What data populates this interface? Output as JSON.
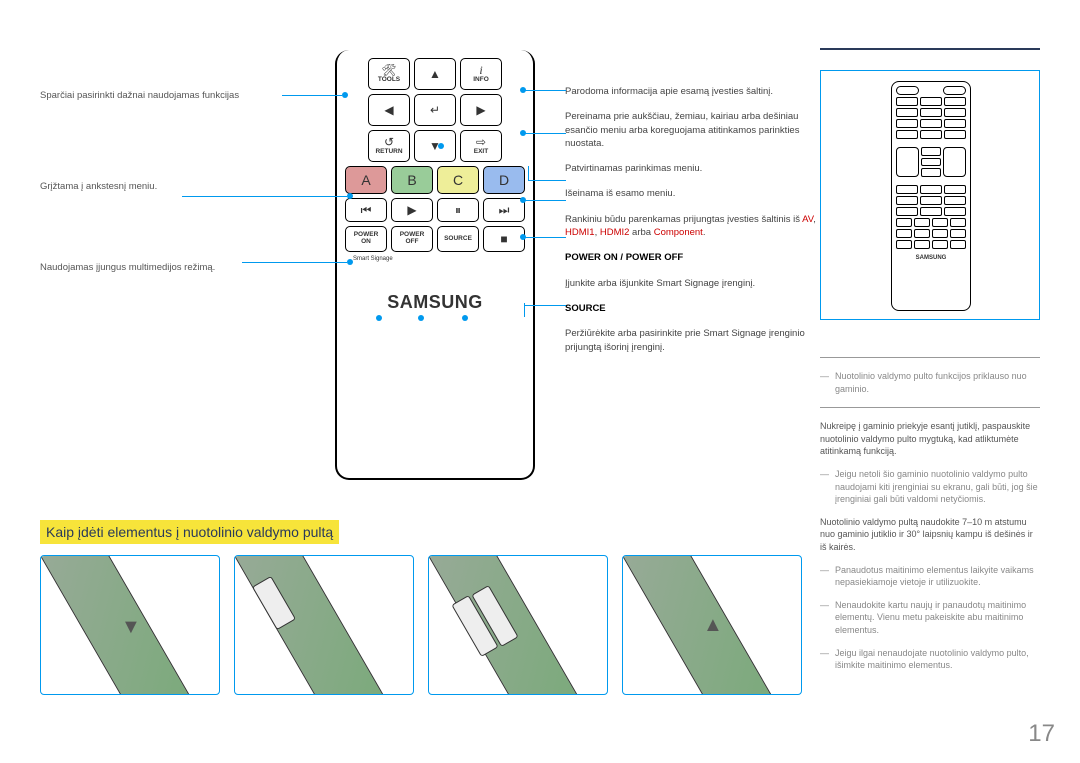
{
  "left": {
    "tools_desc": "Sparčiai pasirinkti dažnai naudojamas funkcijas",
    "return_desc": "Grįžtama į ankstesnį meniu.",
    "media_desc": "Naudojamas įjungus multimedijos režimą."
  },
  "remote": {
    "tools": "TOOLS",
    "info": "INFO",
    "return": "RETURN",
    "exit": "EXIT",
    "a": "A",
    "b": "B",
    "c": "C",
    "d": "D",
    "power_on_top": "POWER",
    "power_on_bot": "ON",
    "power_off_top": "POWER",
    "power_off_bot": "OFF",
    "source": "SOURCE",
    "smart_signage": "Smart Signage",
    "logo": "SAMSUNG",
    "thumb_logo": "SAMSUNG"
  },
  "right": {
    "info": "Parodoma informacija apie esamą įvesties šaltinį.",
    "nav": "Pereinama prie aukščiau, žemiau, kairiau arba dešiniau esančio meniu arba koreguojama atitinkamos parinkties nuostata.",
    "confirm": "Patvirtinamas parinkimas meniu.",
    "exit": "Išeinama iš esamo meniu.",
    "abcd_1": "Rankiniu būdu parenkamas prijungtas įvesties šaltinis iš ",
    "abcd_2": "AV",
    "abcd_3": ", ",
    "abcd_4": "HDMI1",
    "abcd_5": ", ",
    "abcd_6": "HDMI2",
    "abcd_7": " arba ",
    "abcd_8": "Component",
    "abcd_9": ".",
    "power_hdr": "POWER ON / POWER OFF",
    "power_txt": "Įjunkite arba išjunkite Smart Signage įrenginį.",
    "source_hdr": "SOURCE",
    "source_txt": "Peržiūrėkite arba pasirinkite prie Smart Signage įrenginio prijungtą išorinį įrenginį."
  },
  "side": {
    "note1": "Nuotolinio valdymo pulto funkcijos priklauso nuo gaminio.",
    "usage": "Nukreipę į gaminio priekyje esantį jutiklį, paspauskite nuotolinio valdymo pulto mygtuką, kad atliktumėte atitinkamą funkciją.",
    "note2": "Jeigu netoli šio gaminio nuotolinio valdymo pulto naudojami kiti įrenginiai su ekranu, gali būti, jog šie įrenginiai gali būti valdomi netyčiomis.",
    "range": "Nuotolinio valdymo pultą naudokite 7–10 m atstumu nuo gaminio jutiklio ir 30° laipsnių kampu iš dešinės ir iš kairės.",
    "note3": "Panaudotus maitinimo elementus laikyite vaikams nepasiekiamoje vietoje ir utilizuokite.",
    "note4": "Nenaudokite kartu naujų ir panaudotų maitinimo elementų. Vienu metu pakeiskite abu maitinimo elementus.",
    "note5": "Jeigu ilgai nenaudojate nuotolinio valdymo pulto, išimkite maitinimo elementus."
  },
  "battery_heading": "Kaip įdėti elementus į nuotolinio valdymo pultą",
  "page_number": "17"
}
